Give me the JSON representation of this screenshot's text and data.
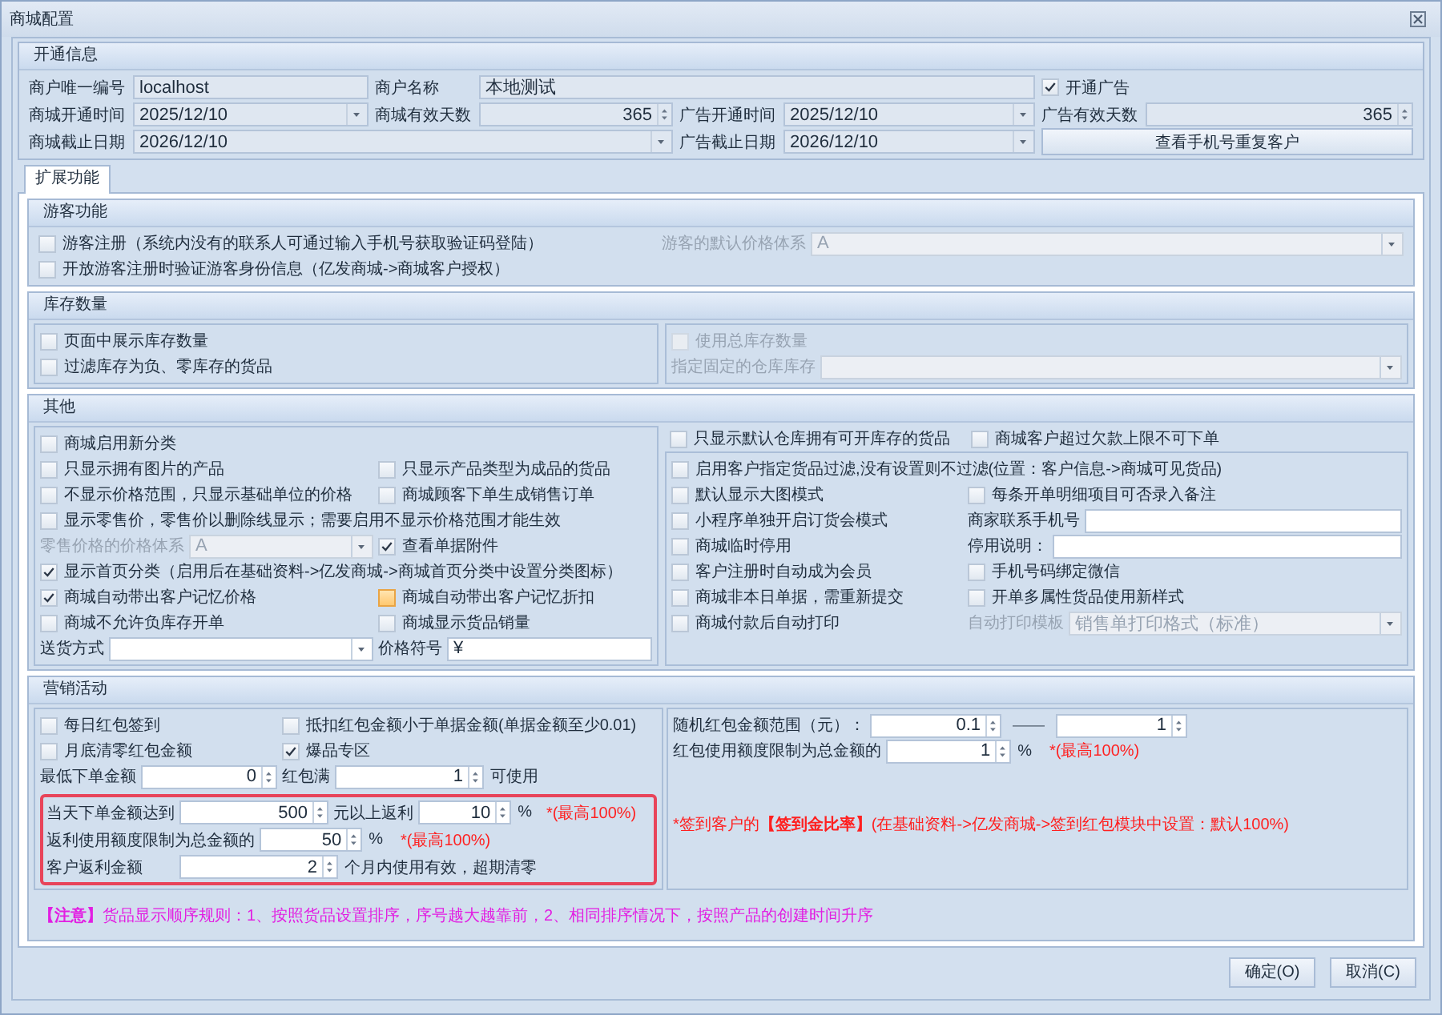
{
  "window": {
    "title": "商城配置"
  },
  "account": {
    "title": "开通信息",
    "fields": [
      {
        "kind": "text",
        "label": "商户唯一编号",
        "value": "localhost",
        "readonly": true
      },
      {
        "kind": "text",
        "label": "商户名称",
        "value": "本地测试",
        "readonly": true
      },
      {
        "kind": "checkbox",
        "label": "开通广告",
        "checked": true
      },
      {
        "kind": "date",
        "label": "商城开通时间",
        "value": "2025/12/10",
        "readonly": true
      },
      {
        "kind": "spin",
        "label": "商城有效天数",
        "value": "365",
        "readonly": true
      },
      {
        "kind": "date",
        "label": "广告开通时间",
        "value": "2025/12/10",
        "readonly": true
      },
      {
        "kind": "spin",
        "label": "广告有效天数",
        "value": "365",
        "readonly": true
      },
      {
        "kind": "date",
        "label": "商城截止日期",
        "value": "2026/12/10",
        "readonly": true
      },
      {
        "kind": "date",
        "label": "广告截止日期",
        "value": "2026/12/10",
        "readonly": true
      },
      {
        "kind": "button",
        "label": "查看手机号重复客户"
      }
    ]
  },
  "tabs": [
    {
      "label": "扩展功能",
      "selected": true
    }
  ],
  "groups": [
    {
      "title": "游客功能",
      "panels": [
        {
          "rows": [
            [
              {
                "kind": "checkbox",
                "label": "游客注册（系统内没有的联系人可通过输入手机号获取验证码登陆）",
                "checked": false
              },
              {
                "kind": "dropdown",
                "label": "游客的默认价格体系",
                "value": "A",
                "disabled": true
              }
            ],
            [
              {
                "kind": "checkbox",
                "label": "开放游客注册时验证游客身份信息（亿发商城->商城客户授权）",
                "checked": false
              }
            ]
          ]
        }
      ]
    },
    {
      "title": "库存数量",
      "panels": [
        {
          "rows": [
            [
              {
                "kind": "checkbox",
                "label": "页面中展示库存数量",
                "checked": false
              }
            ],
            [
              {
                "kind": "checkbox",
                "label": "过滤库存为负、零库存的货品",
                "checked": false
              }
            ]
          ]
        },
        {
          "rows": [
            [
              {
                "kind": "checkbox",
                "label": "使用总库存数量",
                "checked": false,
                "disabled": true
              }
            ],
            [
              {
                "kind": "dropdown",
                "label": "指定固定的仓库库存",
                "disabled": true
              }
            ]
          ]
        }
      ]
    },
    {
      "title": "其他",
      "panels": [
        {
          "rows": [
            [
              {
                "kind": "checkbox",
                "label": "商城启用新分类",
                "checked": false
              }
            ],
            [
              {
                "kind": "checkbox",
                "label": "只显示拥有图片的产品",
                "checked": false
              },
              {
                "kind": "checkbox",
                "label": "只显示产品类型为成品的货品",
                "checked": false
              }
            ],
            [
              {
                "kind": "checkbox",
                "label": "不显示价格范围，只显示基础单位的价格",
                "checked": false
              },
              {
                "kind": "checkbox",
                "label": "商城顾客下单生成销售订单",
                "checked": false
              }
            ],
            [
              {
                "kind": "checkbox",
                "label": "显示零售价，零售价以删除线显示；需要启用不显示价格范围才能生效",
                "checked": false
              }
            ],
            [
              {
                "kind": "dropdown",
                "label": "零售价格的价格体系",
                "value": "A",
                "disabled": true
              },
              {
                "kind": "checkbox",
                "label": "查看单据附件",
                "checked": true
              }
            ],
            [
              {
                "kind": "checkbox",
                "label": "显示首页分类（启用后在基础资料->亿发商城->商城首页分类中设置分类图标）",
                "checked": true
              }
            ],
            [
              {
                "kind": "checkbox",
                "label": "商城自动带出客户记忆价格",
                "checked": true
              },
              {
                "kind": "checkbox",
                "label": "商城自动带出客户记忆折扣",
                "checked": false,
                "focused": true
              }
            ],
            [
              {
                "kind": "checkbox",
                "label": "商城不允许负库存开单",
                "checked": false
              },
              {
                "kind": "checkbox",
                "label": "商城显示货品销量",
                "checked": false
              }
            ],
            [
              {
                "kind": "dropdown",
                "label": "送货方式"
              },
              {
                "kind": "text",
                "label": "价格符号",
                "value": "¥"
              }
            ]
          ]
        },
        {
          "rows": [
            [
              {
                "kind": "checkbox",
                "label": "只显示默认仓库拥有可开库存的货品",
                "checked": false
              },
              {
                "kind": "checkbox",
                "label": "商城客户超过欠款上限不可下单",
                "checked": false
              }
            ]
          ]
        },
        {
          "rows": [
            [
              {
                "kind": "checkbox",
                "label": "启用客户指定货品过滤,没有设置则不过滤(位置：客户信息->商城可见货品)",
                "checked": false
              }
            ],
            [
              {
                "kind": "checkbox",
                "label": "默认显示大图模式",
                "checked": false
              },
              {
                "kind": "checkbox",
                "label": "每条开单明细项目可否录入备注",
                "checked": false
              }
            ],
            [
              {
                "kind": "checkbox",
                "label": "小程序单独开启订货会模式",
                "checked": false
              },
              {
                "kind": "text",
                "label": "商家联系手机号"
              }
            ],
            [
              {
                "kind": "checkbox",
                "label": "商城临时停用",
                "checked": false
              },
              {
                "kind": "text",
                "label": "停用说明："
              }
            ],
            [
              {
                "kind": "checkbox",
                "label": "客户注册时自动成为会员",
                "checked": false
              },
              {
                "kind": "checkbox",
                "label": "手机号码绑定微信",
                "checked": false
              }
            ],
            [
              {
                "kind": "checkbox",
                "label": "商城非本日单据，需重新提交",
                "checked": false
              },
              {
                "kind": "checkbox",
                "label": "开单多属性货品使用新样式",
                "checked": false
              }
            ],
            [
              {
                "kind": "checkbox",
                "label": "商城付款后自动打印",
                "checked": false
              },
              {
                "kind": "dropdown",
                "label": "自动打印模板",
                "value": "销售单打印格式（标准）",
                "disabled": true
              }
            ]
          ]
        }
      ]
    },
    {
      "title": "营销活动",
      "panels": [
        {
          "rows": [
            [
              {
                "kind": "checkbox",
                "label": "每日红包签到",
                "checked": false
              },
              {
                "kind": "checkbox",
                "label": "抵扣红包金额小于单据金额(单据金额至少0.01)",
                "checked": false
              }
            ],
            [
              {
                "kind": "checkbox",
                "label": "月底清零红包金额",
                "checked": false
              },
              {
                "kind": "checkbox",
                "label": "爆品专区",
                "checked": true
              }
            ],
            [
              {
                "kind": "spin",
                "label": "最低下单金额",
                "value": "0"
              },
              {
                "kind": "spin",
                "label": "红包满",
                "value": "1",
                "suffix": "可使用"
              }
            ]
          ],
          "highlighted_rows": [
            [
              {
                "kind": "spin",
                "label": "当天下单金额达到",
                "value": "500"
              },
              {
                "kind": "spin",
                "label": "元以上返利",
                "value": "10",
                "suffix": "%"
              },
              {
                "kind": "note",
                "text": "*(最高100%)",
                "color": "#ff2020"
              }
            ],
            [
              {
                "kind": "spin",
                "label": "返利使用额度限制为总金额的",
                "value": "50",
                "suffix": "%"
              },
              {
                "kind": "note",
                "text": "*(最高100%)",
                "color": "#ff2020"
              }
            ],
            [
              {
                "kind": "spin",
                "label": "客户返利金额",
                "value": "2",
                "suffix": "个月内使用有效，超期清零"
              }
            ]
          ]
        },
        {
          "rows": [
            [
              {
                "kind": "spin",
                "label": "随机红包金额范围（元）：",
                "value": "0.1",
                "suffix": "——"
              },
              {
                "kind": "spin",
                "value": "1"
              }
            ],
            [
              {
                "kind": "spin",
                "label": "红包使用额度限制为总金额的",
                "value": "1",
                "suffix": "%"
              },
              {
                "kind": "note",
                "text": "*(最高100%)",
                "color": "#ff2020"
              }
            ],
            [
              {
                "kind": "note",
                "text": "*签到客户的**【签到金比率】**(在基础资料->亿发商城->签到红包模块中设置：默认100%)",
                "color": "#ff2020"
              }
            ]
          ]
        },
        {
          "rows": [
            [
              {
                "kind": "note",
                "text": "**【注意】**货品显示顺序规则：1、按照货品设置排序，序号越大越靠前，2、相同排序情况下，按照产品的创建时间升序",
                "color": "#e21ee2"
              }
            ]
          ]
        }
      ]
    }
  ],
  "buttons": [
    {
      "label": "确定(O)"
    },
    {
      "label": "取消(C)"
    }
  ]
}
